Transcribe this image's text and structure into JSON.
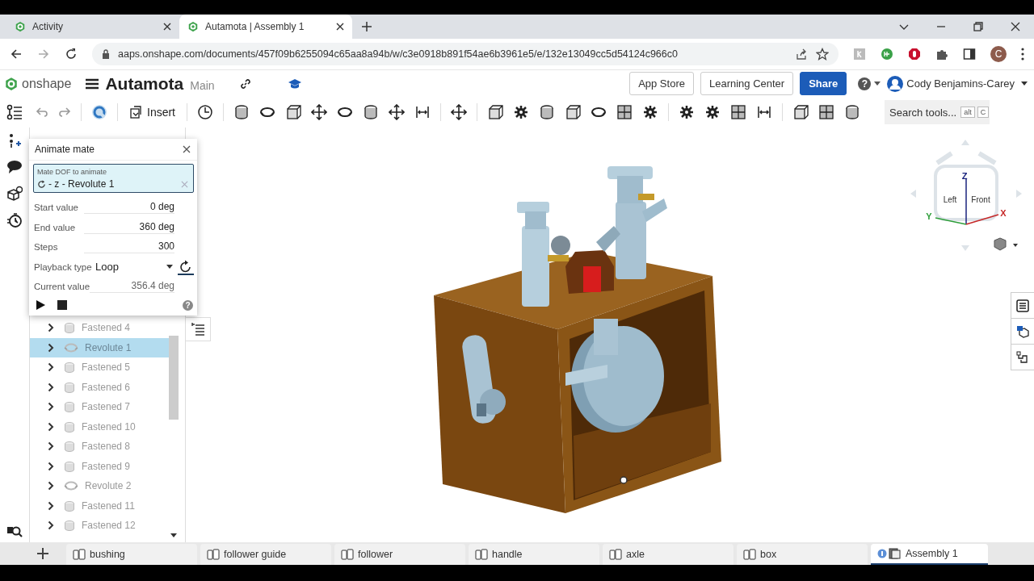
{
  "browser": {
    "tabs": [
      {
        "title": "Activity",
        "selected": false
      },
      {
        "title": "Autamota | Assembly 1",
        "selected": true
      }
    ],
    "url": "aaps.onshape.com/documents/457f09b6255094c65aa8a94b/w/c3e0918b891f54ae6b3961e5/e/132e13049cc5d54124c966c0",
    "profile_initial": "C"
  },
  "header": {
    "logo": "onshape",
    "document": "Autamota",
    "workspace": "Main",
    "buttons": [
      {
        "label": "App Store",
        "kind": "plain"
      },
      {
        "label": "Learning Center",
        "kind": "plain"
      },
      {
        "label": "Share",
        "kind": "primary"
      }
    ],
    "help": "?",
    "user": "Cody Benjamins-Carey"
  },
  "toolbar": {
    "insert": "Insert",
    "search": {
      "placeholder": "Search tools...",
      "keys": [
        "alt",
        "C"
      ]
    }
  },
  "dialog": {
    "title": "Animate mate",
    "mate": {
      "label": "Mate DOF to animate",
      "value": "- z - Revolute 1"
    },
    "rows": [
      {
        "kind": "input",
        "label": "Start value",
        "value": "0 deg"
      },
      {
        "kind": "input",
        "label": "End value",
        "value": "360 deg"
      },
      {
        "kind": "input",
        "label": "Steps",
        "value": "300"
      },
      {
        "kind": "select",
        "label": "Playback type",
        "value": "Loop"
      },
      {
        "kind": "readout",
        "label": "Current value",
        "value": "356.4 deg"
      }
    ],
    "help": "?"
  },
  "tree": {
    "items": [
      {
        "label": "Fastened 4",
        "kind": "fastened",
        "selected": false
      },
      {
        "label": "Revolute 1",
        "kind": "revolute",
        "selected": true
      },
      {
        "label": "Fastened 5",
        "kind": "fastened",
        "selected": false
      },
      {
        "label": "Fastened 6",
        "kind": "fastened",
        "selected": false
      },
      {
        "label": "Fastened 7",
        "kind": "fastened",
        "selected": false
      },
      {
        "label": "Fastened 10",
        "kind": "fastened",
        "selected": false
      },
      {
        "label": "Fastened 8",
        "kind": "fastened",
        "selected": false
      },
      {
        "label": "Fastened 9",
        "kind": "fastened",
        "selected": false
      },
      {
        "label": "Revolute 2",
        "kind": "revolute",
        "selected": false
      },
      {
        "label": "Fastened 11",
        "kind": "fastened",
        "selected": false
      },
      {
        "label": "Fastened 12",
        "kind": "fastened",
        "selected": false
      }
    ]
  },
  "view_cube": {
    "faces": [
      "Left",
      "Front"
    ],
    "axes": [
      {
        "label": "Z",
        "color": "#1a237e"
      },
      {
        "label": "Y",
        "color": "#2e9e3a"
      },
      {
        "label": "X",
        "color": "#c62828"
      }
    ]
  },
  "tabs": [
    {
      "label": "bushing",
      "kind": "part-studio",
      "selected": false
    },
    {
      "label": "follower guide",
      "kind": "part-studio",
      "selected": false
    },
    {
      "label": "follower",
      "kind": "part-studio",
      "selected": false
    },
    {
      "label": "handle",
      "kind": "part-studio",
      "selected": false
    },
    {
      "label": "axle",
      "kind": "part-studio",
      "selected": false
    },
    {
      "label": "box",
      "kind": "part-studio",
      "selected": false
    },
    {
      "label": "Assembly 1",
      "kind": "assembly",
      "selected": true
    }
  ]
}
